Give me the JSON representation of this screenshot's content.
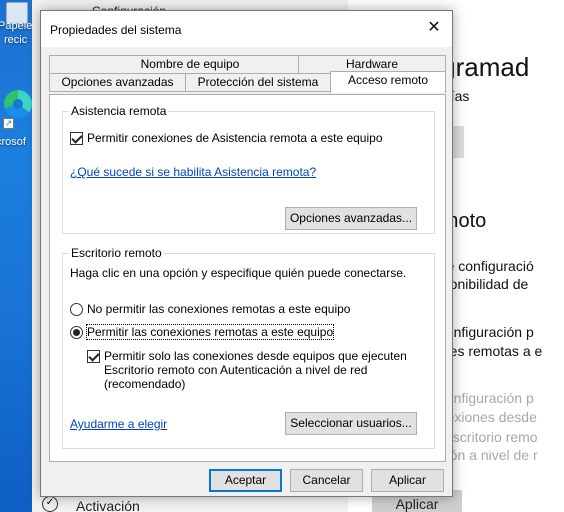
{
  "desktop": {
    "icons": [
      {
        "label": "Papele",
        "label2": "recic"
      },
      {
        "label": "crosof"
      }
    ]
  },
  "settings": {
    "title": "Configuración",
    "heading": "rogramad",
    "subheading": "s vacías",
    "section_title": "remoto",
    "lines": [
      "iente configuració",
      "disponibilidad de",
      "la configuración p",
      "xiones remotas a e"
    ],
    "faded_lines": [
      "la configuración p",
      "conexiones desde",
      "un Escritorio remo",
      "nexión a nivel de r"
    ],
    "activation": "Activación",
    "apply": "Aplicar"
  },
  "dialog": {
    "title": "Propiedades del sistema",
    "tabs_row1": [
      "Nombre de equipo",
      "Hardware"
    ],
    "tabs_row2": [
      "Opciones avanzadas",
      "Protección del sistema",
      "Acceso remoto"
    ],
    "active_tab": "Acceso remoto",
    "remote_assistance": {
      "group_label": "Asistencia remota",
      "checkbox_label": "Permitir conexiones de Asistencia remota a este equipo",
      "checked": true,
      "link": "¿Qué sucede si se habilita Asistencia remota?",
      "advanced_button": "Opciones avanzadas..."
    },
    "remote_desktop": {
      "group_label": "Escritorio remoto",
      "instruction": "Haga clic en una opción y especifique quién puede conectarse.",
      "radio_deny": "No permitir las conexiones remotas a este equipo",
      "radio_allow": "Permitir las conexiones remotas a este equipo",
      "selected": "allow",
      "nla_line1": "Permitir solo las conexiones desde equipos que ejecuten",
      "nla_line2": "Escritorio remoto con Autenticación a nivel de red",
      "nla_line3": "(recomendado)",
      "nla_checked": true,
      "help_link": "Ayudarme a elegir",
      "select_users_button": "Seleccionar usuarios..."
    },
    "buttons": {
      "ok": "Aceptar",
      "cancel": "Cancelar",
      "apply": "Aplicar"
    }
  }
}
